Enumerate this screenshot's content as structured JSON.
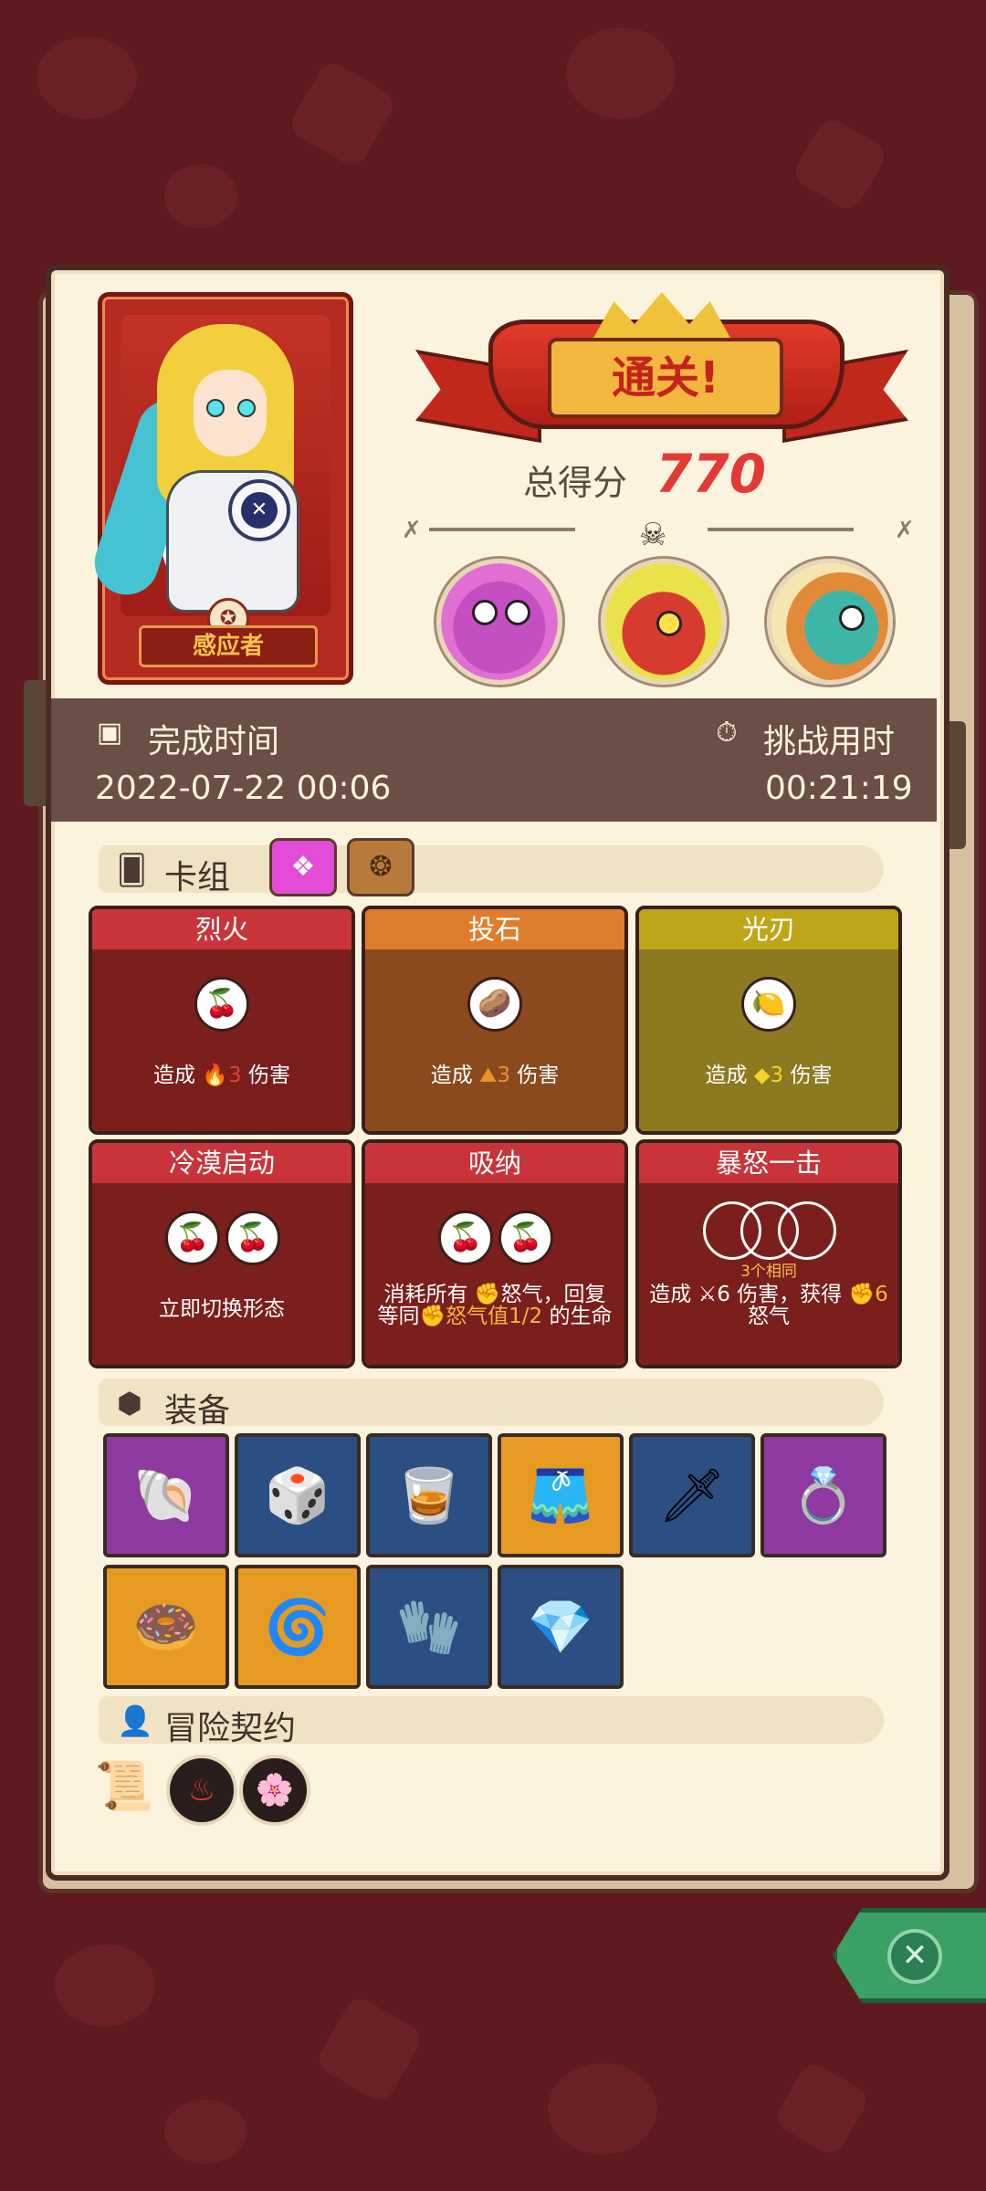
{
  "character": {
    "name": "感应者",
    "name_color": "#f6c34b"
  },
  "result": {
    "banner_text": "通关!",
    "score_label": "总得分",
    "score_value": "770",
    "score_color": "#e33a36"
  },
  "bosses": [
    {
      "icon": "purple-demon-mask-icon"
    },
    {
      "icon": "red-ogre-boss-icon"
    },
    {
      "icon": "fish-beast-boss-icon"
    }
  ],
  "completion": {
    "time_label": "完成时间",
    "time_value": "2022-07-22 00:06",
    "duration_label": "挑战用时",
    "duration_value": "00:21:19"
  },
  "deck": {
    "label": "卡组",
    "cards": [
      {
        "title": "烈火",
        "desc_pre": "造成",
        "desc_icon": "🔥",
        "desc_value": "3",
        "desc_post": "伤害",
        "slot_icons": [
          "🍒"
        ]
      },
      {
        "title": "投石",
        "desc_pre": "造成",
        "desc_icon": "⛰",
        "desc_value": "3",
        "desc_post": "伤害",
        "slot_icons": [
          "🥔"
        ]
      },
      {
        "title": "光刃",
        "desc_pre": "造成",
        "desc_icon": "◆",
        "desc_value": "3",
        "desc_post": "伤害",
        "slot_icons": [
          "🍋"
        ]
      },
      {
        "title": "冷漠启动",
        "desc": "立即切换形态",
        "slot_icons": [
          "🍒",
          "🍒"
        ]
      },
      {
        "title": "吸纳",
        "desc_line1": "消耗所有",
        "desc_rage": "怒气，回复",
        "desc_equal": "等同",
        "desc_rage_half": "怒气值1/2",
        "desc_life": "的生命",
        "slot_icons": [
          "🍒",
          "🍒"
        ]
      },
      {
        "title": "暴怒一击",
        "sub": "3个相同",
        "desc_pre": "造成",
        "desc_value": "6",
        "desc_mid": "伤害，获得",
        "desc_gain": "6",
        "desc_post": "怒气",
        "slot_icons": [
          "",
          "",
          ""
        ]
      }
    ]
  },
  "equipment": {
    "label": "装备",
    "items": [
      {
        "icon": "🐚",
        "rarity": "purple"
      },
      {
        "icon": "🎲",
        "rarity": "blue"
      },
      {
        "icon": "🥃",
        "rarity": "blue"
      },
      {
        "icon": "🩳",
        "rarity": "orange"
      },
      {
        "icon": "🗡",
        "rarity": "blue"
      },
      {
        "icon": "💍",
        "rarity": "purple"
      },
      {
        "icon": "🍩",
        "rarity": "orange"
      },
      {
        "icon": "🌀",
        "rarity": "orange"
      },
      {
        "icon": "🧤",
        "rarity": "blue"
      },
      {
        "icon": "💎",
        "rarity": "blue"
      }
    ]
  },
  "contracts": {
    "label": "冒险契约",
    "items": [
      {
        "icon": "scroll-icon",
        "glyph": "📜"
      },
      {
        "icon": "demon-contract-icon",
        "glyph": "♨"
      },
      {
        "icon": "flower-contract-icon",
        "glyph": "🌸"
      }
    ]
  },
  "close": {
    "icon": "close-icon",
    "glyph": "✕"
  }
}
